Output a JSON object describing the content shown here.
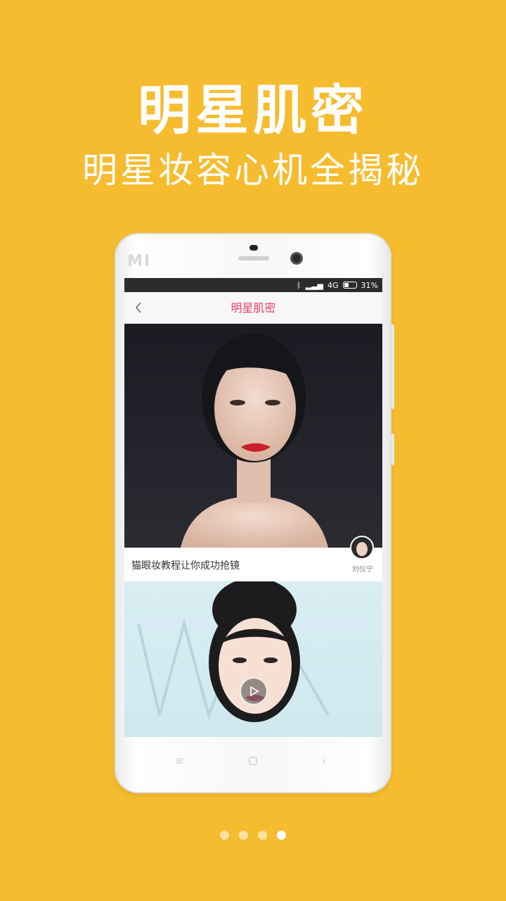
{
  "headline": "明星肌密",
  "subline": "明星妆容心机全揭秘",
  "phone": {
    "brand_logo": "MI",
    "status_bar": {
      "network": "4G",
      "battery": "31%"
    },
    "nav": {
      "back_icon": "chevron-left-icon",
      "title": "明星肌密"
    },
    "cards": [
      {
        "caption": "猫眼妆教程让你成功抢镜",
        "author": "刘仪宁"
      },
      {
        "caption": "",
        "has_play": true
      }
    ],
    "softkeys": [
      "menu-icon",
      "home-icon",
      "back-icon"
    ]
  },
  "pager": {
    "count": 4,
    "active_index": 3
  }
}
